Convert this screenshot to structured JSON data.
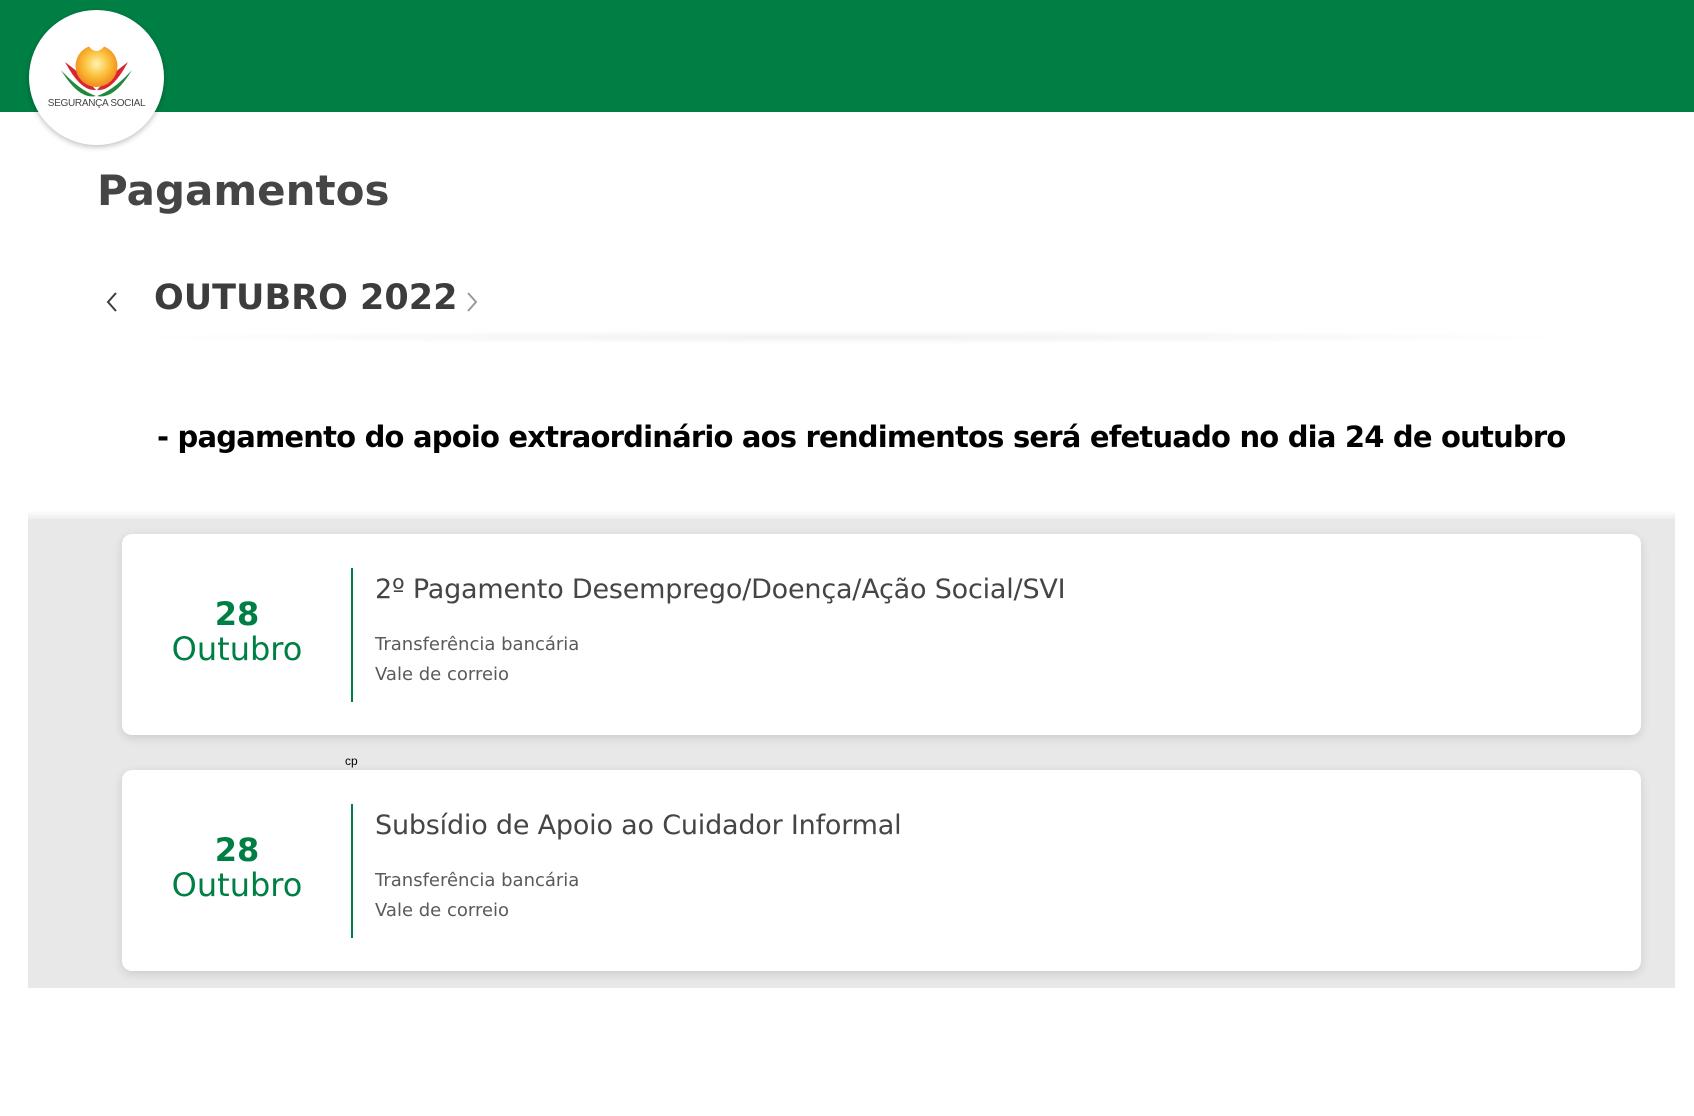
{
  "header": {
    "logo_text": "SEGURANÇA SOCIAL",
    "brand_color": "#007f44"
  },
  "page": {
    "title": "Pagamentos"
  },
  "month_nav": {
    "label": "OUTUBRO 2022",
    "prev_icon": "chevron-left-icon",
    "next_icon": "chevron-right-icon"
  },
  "notice": "- pagamento do apoio extraordinário aos rendimentos será efetuado no dia 24 de outubro",
  "payments": [
    {
      "day": "28",
      "month": "Outubro",
      "title": "2º Pagamento Desemprego/Doença/Ação Social/SVI",
      "methods": [
        "Transferência bancária",
        "Vale de correio"
      ]
    },
    {
      "day": "28",
      "month": "Outubro",
      "title": "Subsídio de Apoio ao Cuidador Informal",
      "methods": [
        "Transferência bancária",
        "Vale de correio"
      ]
    }
  ],
  "annotation": "cp"
}
